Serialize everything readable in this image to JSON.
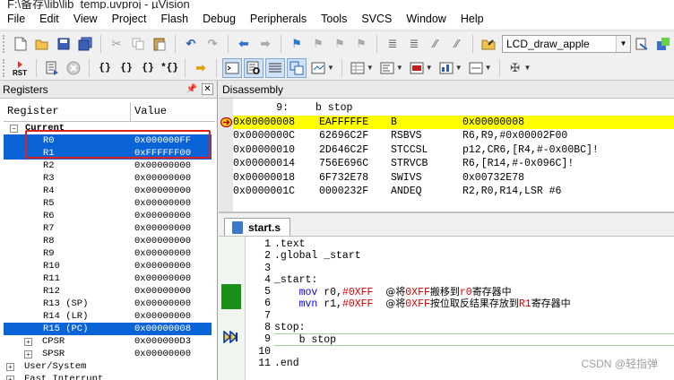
{
  "window": {
    "title": "F:\\备存\\lib\\lib_temp.uvproj - µVision"
  },
  "menu": [
    "File",
    "Edit",
    "View",
    "Project",
    "Flash",
    "Debug",
    "Peripherals",
    "Tools",
    "SVCS",
    "Window",
    "Help"
  ],
  "toolbar": {
    "target": "LCD_draw_apple",
    "rst_label": "RST"
  },
  "registers_panel": {
    "title": "Registers",
    "col_register": "Register",
    "col_value": "Value",
    "group_current": "Current",
    "rows": [
      {
        "name": "R0",
        "value": "0x000000FF",
        "selected": true
      },
      {
        "name": "R1",
        "value": "0xFFFFFF00",
        "selected": true
      },
      {
        "name": "R2",
        "value": "0x00000000",
        "selected": false
      },
      {
        "name": "R3",
        "value": "0x00000000",
        "selected": false
      },
      {
        "name": "R4",
        "value": "0x00000000",
        "selected": false
      },
      {
        "name": "R5",
        "value": "0x00000000",
        "selected": false
      },
      {
        "name": "R6",
        "value": "0x00000000",
        "selected": false
      },
      {
        "name": "R7",
        "value": "0x00000000",
        "selected": false
      },
      {
        "name": "R8",
        "value": "0x00000000",
        "selected": false
      },
      {
        "name": "R9",
        "value": "0x00000000",
        "selected": false
      },
      {
        "name": "R10",
        "value": "0x00000000",
        "selected": false
      },
      {
        "name": "R11",
        "value": "0x00000000",
        "selected": false
      },
      {
        "name": "R12",
        "value": "0x00000000",
        "selected": false
      },
      {
        "name": "R13 (SP)",
        "value": "0x00000000",
        "selected": false
      },
      {
        "name": "R14 (LR)",
        "value": "0x00000000",
        "selected": false
      },
      {
        "name": "R15 (PC)",
        "value": "0x00000008",
        "selected": true
      }
    ],
    "cpsr": {
      "name": "CPSR",
      "value": "0x000000D3"
    },
    "spsr": {
      "name": "SPSR",
      "value": "0x00000000"
    },
    "group_user_system": "User/System",
    "group_fast_interrupt": "Fast Interrupt"
  },
  "disassembly": {
    "title": "Disassembly",
    "source_line": {
      "num": "9:",
      "text": "b stop"
    },
    "rows": [
      {
        "addr": "0x00000008",
        "opcode": "EAFFFFFE",
        "mnemonic": "B",
        "args": "0x00000008",
        "current": true
      },
      {
        "addr": "0x0000000C",
        "opcode": "62696C2F",
        "mnemonic": "RSBVS",
        "args": "R6,R9,#0x00002F00",
        "current": false
      },
      {
        "addr": "0x00000010",
        "opcode": "2D646C2F",
        "mnemonic": "STCCSL",
        "args": "p12,CR6,[R4,#-0x00BC]!",
        "current": false
      },
      {
        "addr": "0x00000014",
        "opcode": "756E696C",
        "mnemonic": "STRVCB",
        "args": "R6,[R14,#-0x096C]!",
        "current": false
      },
      {
        "addr": "0x00000018",
        "opcode": "6F732E78",
        "mnemonic": "SWIVS",
        "args": "0x00732E78",
        "current": false
      },
      {
        "addr": "0x0000001C",
        "opcode": "0000232F",
        "mnemonic": "ANDEQ",
        "args": "R2,R0,R14,LSR #6",
        "current": false
      }
    ]
  },
  "editor": {
    "tab": "start.s",
    "lines": [
      {
        "n": "1",
        "code": ".text"
      },
      {
        "n": "2",
        "code": ".global _start"
      },
      {
        "n": "3",
        "code": ""
      },
      {
        "n": "4",
        "code": "_start:"
      },
      {
        "n": "5",
        "code": "    mov r0,#0XFF  @将0XFF搬移到r0寄存器中"
      },
      {
        "n": "6",
        "code": "    mvn r1,#0XFF  @将0XFF按位取反结果存放到R1寄存器中"
      },
      {
        "n": "7",
        "code": ""
      },
      {
        "n": "8",
        "code": "stop:"
      },
      {
        "n": "9",
        "code": "    b stop"
      },
      {
        "n": "10",
        "code": ""
      },
      {
        "n": "11",
        "code": ".end"
      }
    ],
    "line5": {
      "indent": "    ",
      "kw": "mov",
      "reg": " r0,",
      "imm": "#0XFF",
      "pad": "  ",
      "c1": "@将",
      "c2": "0XFF",
      "c3": "搬移到",
      "c4": "r0",
      "c5": "寄存器中"
    },
    "line6": {
      "indent": "    ",
      "kw": "mvn",
      "reg": " r1,",
      "imm": "#0XFF",
      "pad": "  ",
      "c1": "@将",
      "c2": "0XFF",
      "c3": "按位取反结果存放到",
      "c4": "R1",
      "c5": "寄存器中"
    }
  },
  "watermark": "CSDN @轻指弹"
}
